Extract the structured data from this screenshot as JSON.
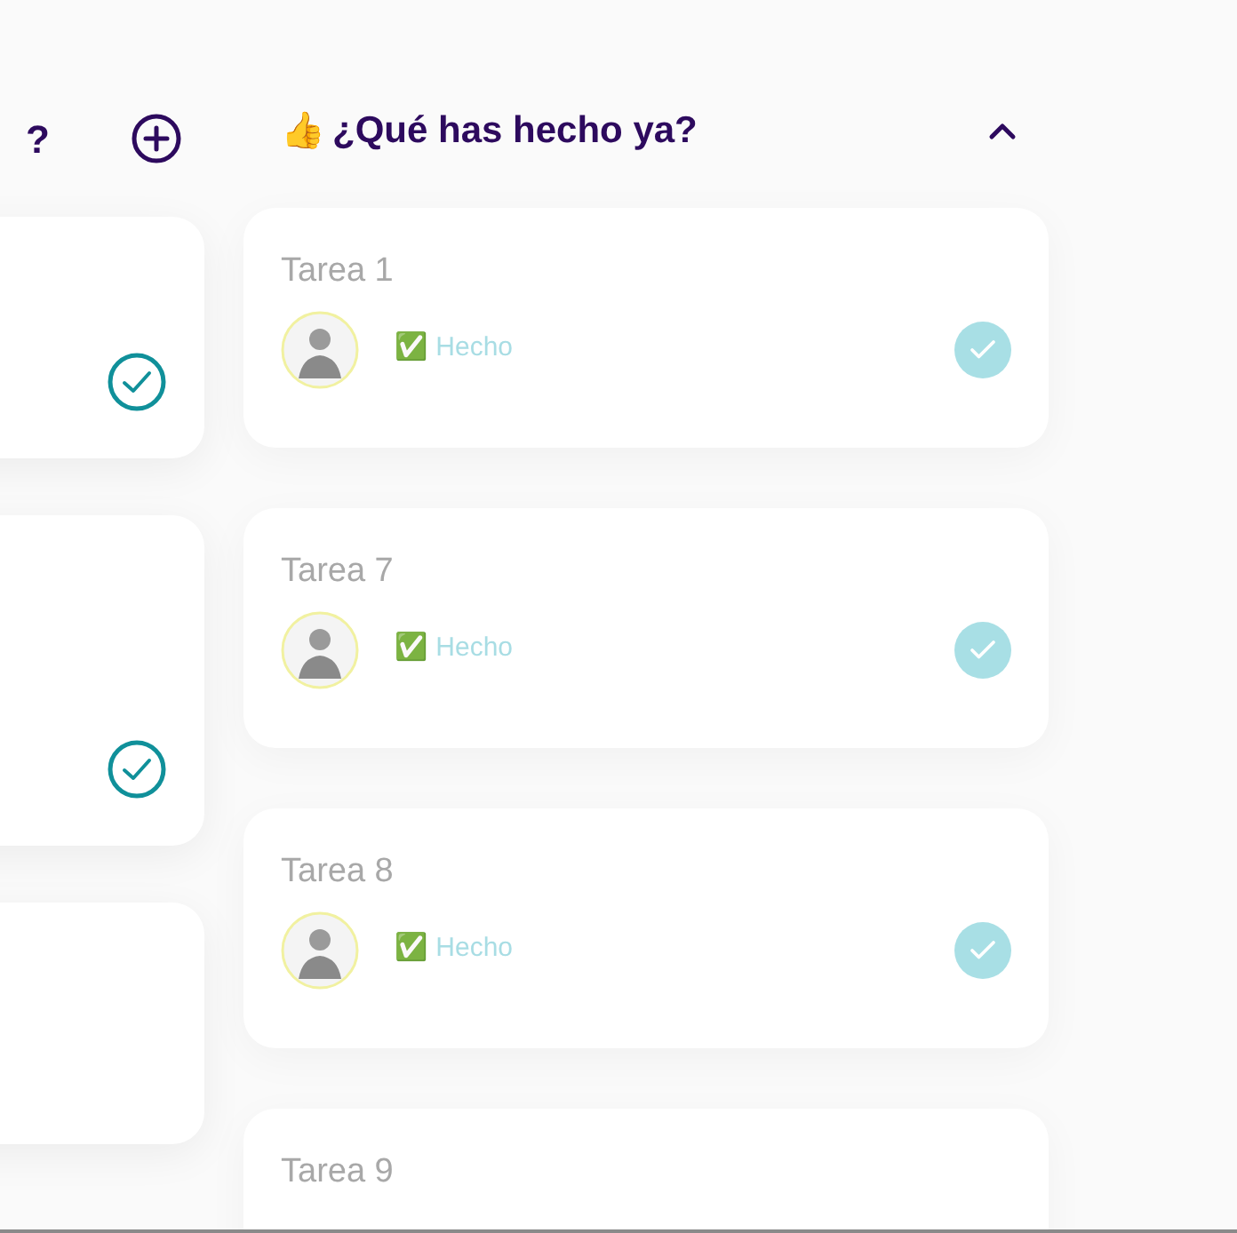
{
  "left_column": {
    "title": "?",
    "cards": [
      {
        "done": true
      },
      {
        "done": true
      }
    ]
  },
  "right_column": {
    "emoji": "👍",
    "title": "¿Qué has hecho ya?",
    "expanded": true,
    "cards": [
      {
        "title": "Tarea 1",
        "status": "✅ Hecho",
        "done": true
      },
      {
        "title": "Tarea 7",
        "status": "✅ Hecho",
        "done": true
      },
      {
        "title": "Tarea 8",
        "status": "✅ Hecho",
        "done": true
      },
      {
        "title": "Tarea 9"
      }
    ]
  }
}
